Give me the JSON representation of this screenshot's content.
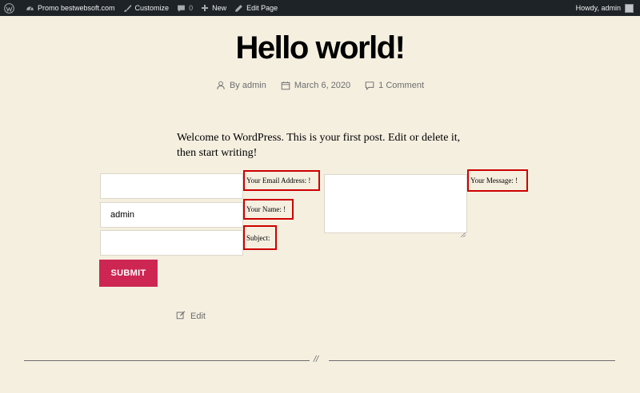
{
  "adminbar": {
    "site_name": "Promo bestwebsoft.com",
    "customize": "Customize",
    "comments_count": "0",
    "new": "New",
    "edit_page": "Edit Page",
    "howdy": "Howdy, admin",
    "icons": [
      "wordpress-icon",
      "dashboard-icon",
      "brush-icon",
      "comment-icon",
      "plus-icon",
      "pencil-icon"
    ]
  },
  "post": {
    "title": "Hello world!",
    "author": "By admin",
    "date": "March 6, 2020",
    "comments": "1 Comment",
    "content": "Welcome to WordPress. This is your first post. Edit or delete it, then start writing!"
  },
  "form": {
    "email_value": "",
    "email_label": "Your Email Address: !",
    "name_value": "admin",
    "name_label": "Your Name: !",
    "subject_value": "",
    "subject_label": "Subject:",
    "message_label": "Your Message: !",
    "submit_label": "SUBMIT",
    "label_border_color": "#cd0000"
  },
  "footer": {
    "edit_label": "Edit",
    "separator_mark": "//"
  },
  "colors": {
    "background": "#f5efe0",
    "accent": "#cd2653",
    "adminbar": "#1d2327"
  }
}
